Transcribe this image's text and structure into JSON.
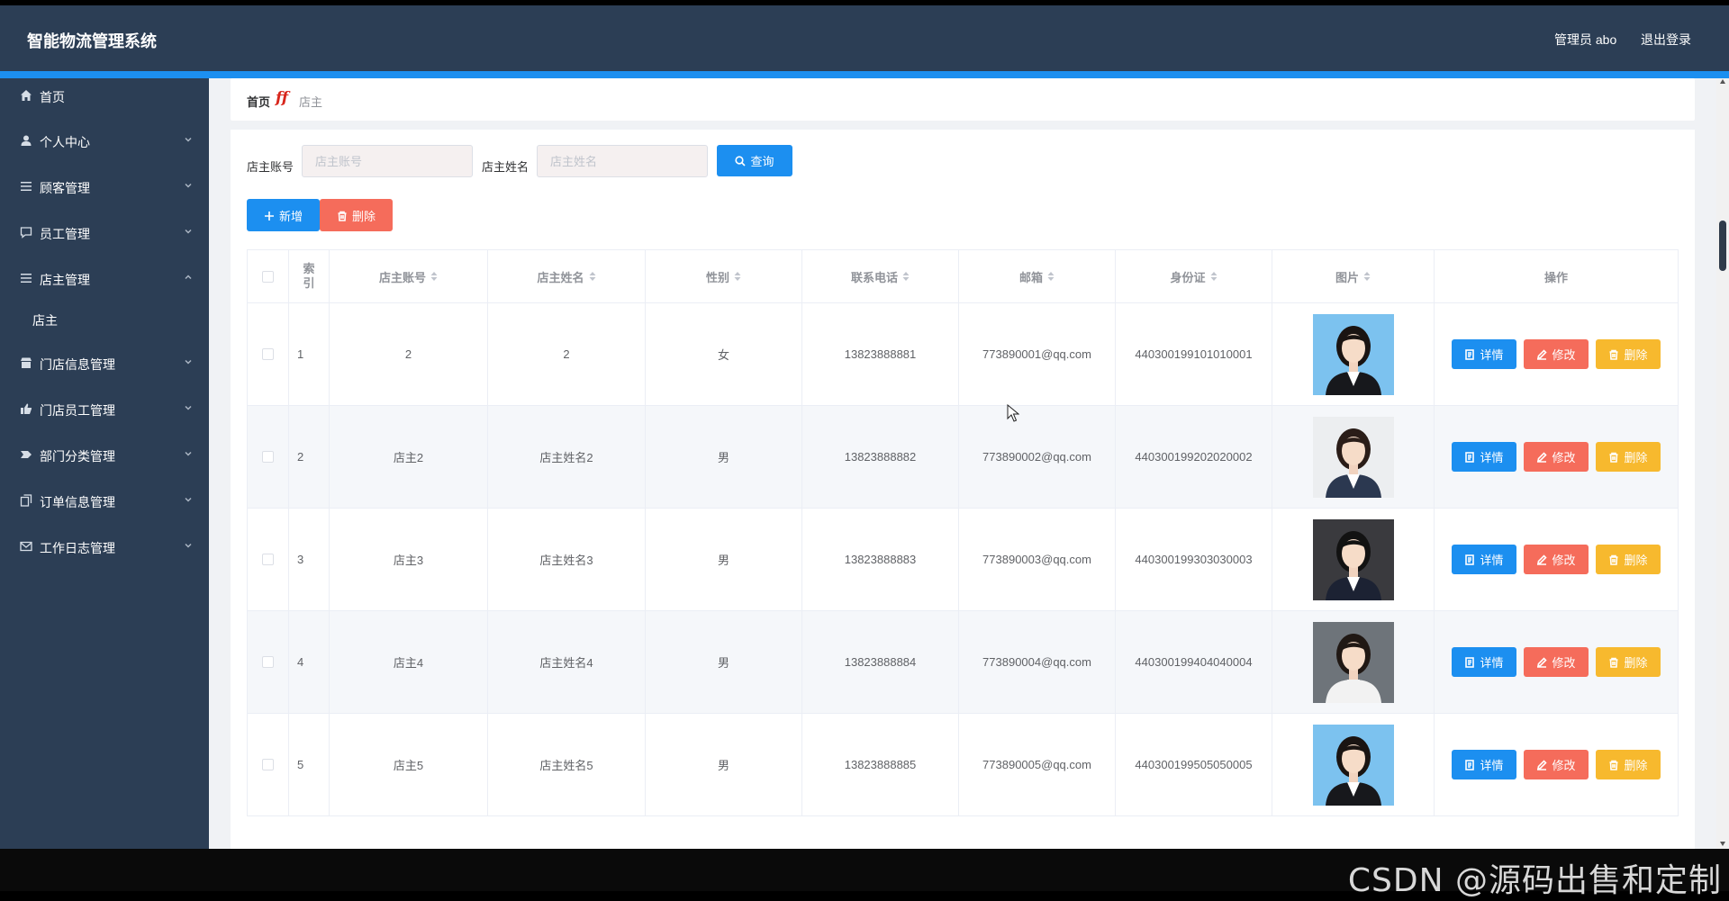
{
  "header": {
    "app_title": "智能物流管理系统",
    "user_label": "管理员 abo",
    "logout_label": "退出登录"
  },
  "sidebar": {
    "items": [
      {
        "label": "首页",
        "icon": "home-icon"
      },
      {
        "label": "个人中心",
        "icon": "user-icon"
      },
      {
        "label": "顾客管理",
        "icon": "menu-icon"
      },
      {
        "label": "员工管理",
        "icon": "chat-icon"
      },
      {
        "label": "店主管理",
        "icon": "menu-icon",
        "expanded": true
      },
      {
        "label": "门店信息管理",
        "icon": "shop-icon"
      },
      {
        "label": "门店员工管理",
        "icon": "thumb-icon"
      },
      {
        "label": "部门分类管理",
        "icon": "tag-icon"
      },
      {
        "label": "订单信息管理",
        "icon": "copy-icon"
      },
      {
        "label": "工作日志管理",
        "icon": "mail-icon"
      }
    ],
    "subitem": "店主"
  },
  "breadcrumb": {
    "home": "首页",
    "current": "店主"
  },
  "filters": {
    "account_label": "店主账号",
    "account_placeholder": "店主账号",
    "name_label": "店主姓名",
    "name_placeholder": "店主姓名",
    "search_label": "查询"
  },
  "actions": {
    "add_label": "新增",
    "delete_label": "删除"
  },
  "table": {
    "columns": [
      "索引",
      "店主账号",
      "店主姓名",
      "性别",
      "联系电话",
      "邮箱",
      "身份证",
      "图片",
      "操作"
    ],
    "rows": [
      {
        "index": "1",
        "account": "2",
        "name": "2",
        "gender": "女",
        "phone": "13823888881",
        "email": "773890001@qq.com",
        "id_card": "440300199101010001",
        "photo": "woman-blue-bg"
      },
      {
        "index": "2",
        "account": "店主2",
        "name": "店主姓名2",
        "gender": "男",
        "phone": "13823888882",
        "email": "773890002@qq.com",
        "id_card": "440300199202020002",
        "photo": "woman-light-bg"
      },
      {
        "index": "3",
        "account": "店主3",
        "name": "店主姓名3",
        "gender": "男",
        "phone": "13823888883",
        "email": "773890003@qq.com",
        "id_card": "440300199303030003",
        "photo": "man-dark-bg"
      },
      {
        "index": "4",
        "account": "店主4",
        "name": "店主姓名4",
        "gender": "男",
        "phone": "13823888884",
        "email": "773890004@qq.com",
        "id_card": "440300199404040004",
        "photo": "woman-grey-bg"
      },
      {
        "index": "5",
        "account": "店主5",
        "name": "店主姓名5",
        "gender": "男",
        "phone": "13823888885",
        "email": "773890005@qq.com",
        "id_card": "440300199505050005",
        "photo": "woman-blue-bg"
      }
    ],
    "op_detail": "详情",
    "op_edit": "修改",
    "op_delete": "删除"
  },
  "watermark": "CSDN @源码出售和定制",
  "colors": {
    "header_bg": "#2c3e55",
    "primary": "#1c8ff0",
    "danger": "#f56c5b",
    "warning": "#f7b92e"
  }
}
